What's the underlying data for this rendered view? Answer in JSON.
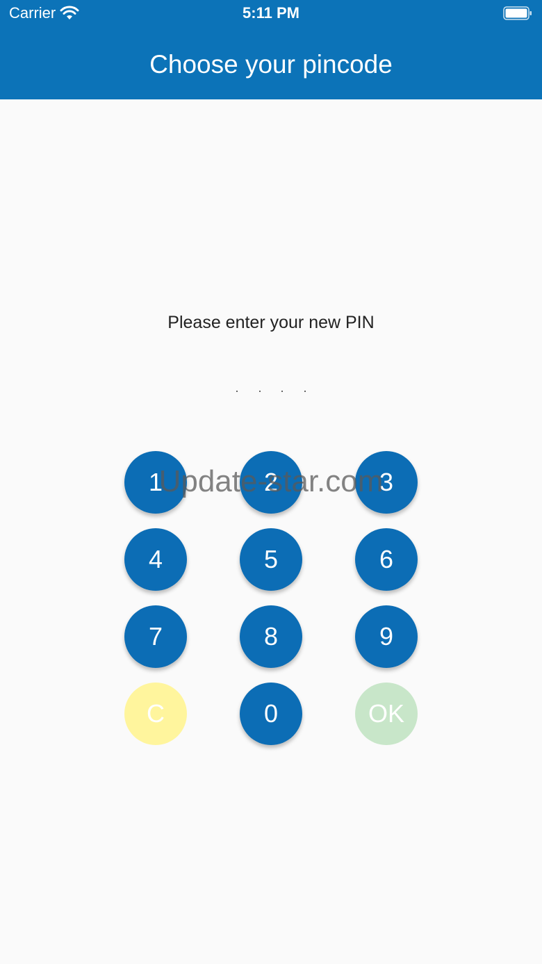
{
  "status_bar": {
    "carrier": "Carrier",
    "time": "5:11 PM"
  },
  "header": {
    "title": "Choose your pincode",
    "background": "#0c73b8"
  },
  "pin_entry": {
    "prompt": "Please enter your new PIN",
    "dot_count": 4
  },
  "keypad": {
    "keys": [
      "1",
      "2",
      "3",
      "4",
      "5",
      "6",
      "7",
      "8",
      "9",
      "C",
      "0",
      "OK"
    ],
    "key_color": "#0c6db5",
    "clear_color": "#fff59d",
    "ok_color": "#c8e6c9"
  },
  "watermark": "Update-star.com"
}
